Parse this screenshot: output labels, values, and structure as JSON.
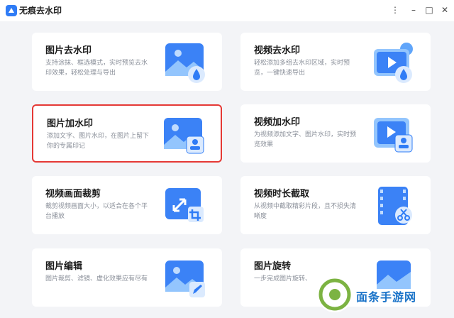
{
  "window": {
    "title": "无痕去水印",
    "minimize": "–",
    "maximize": "□",
    "close": "✕",
    "menu": "⋮"
  },
  "cards": [
    {
      "title": "图片去水印",
      "desc": "支持涂抹、框选模式，实时预览去水印效果，轻松处理与导出"
    },
    {
      "title": "视频去水印",
      "desc": "轻松添加多组去水印区域，实时预览，一键快速导出"
    },
    {
      "title": "图片加水印",
      "desc": "添加文字、图片水印，在图片上留下你的专属印记"
    },
    {
      "title": "视频加水印",
      "desc": "为视频添加文字、图片水印，实时预览效果"
    },
    {
      "title": "视频画面裁剪",
      "desc": "裁剪视频画面大小，以适合在各个平台播放"
    },
    {
      "title": "视频时长截取",
      "desc": "从视频中截取精彩片段，且不损失清晰度"
    },
    {
      "title": "图片编辑",
      "desc": "图片裁剪、滤镜、虚化效果应有尽有"
    },
    {
      "title": "图片旋转",
      "desc": "一步完成图片旋转、"
    }
  ],
  "watermark": {
    "text": "面条手游网"
  },
  "colors": {
    "accent": "#2f7cf6",
    "selected_border": "#e53935"
  }
}
